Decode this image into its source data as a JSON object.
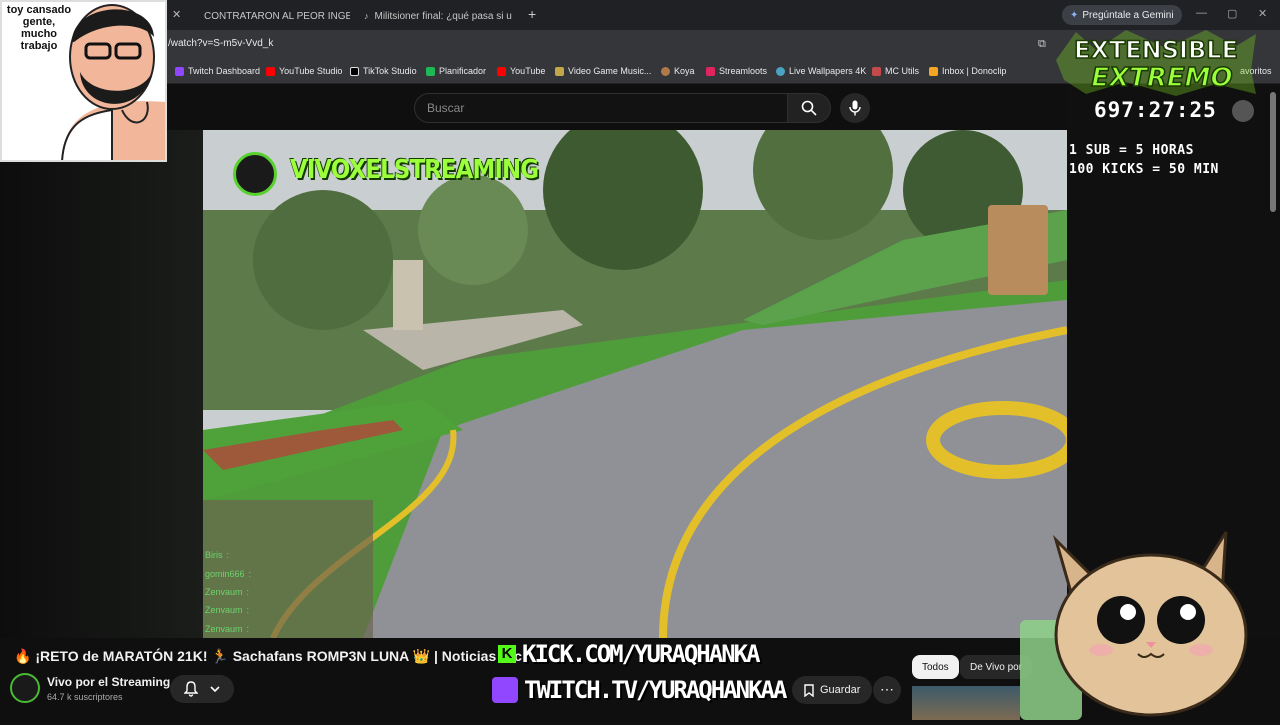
{
  "tabs": [
    {
      "label": "CONTRATARON AL PEOR INGE",
      "icon": "youtube-icon"
    },
    {
      "label": "Militsioner final: ¿qué pasa si u",
      "icon": "tiktok-icon"
    }
  ],
  "address": {
    "url": "/watch?v=S-m5v-Vvd_k"
  },
  "gemini": {
    "label": "Pregúntale a Gemini"
  },
  "bookmarks": [
    {
      "label": "Twitch Dashboard",
      "color": "#9146ff"
    },
    {
      "label": "YouTube Studio",
      "color": "#ff0000"
    },
    {
      "label": "TikTok Studio",
      "color": "#222222"
    },
    {
      "label": "Planificador",
      "color": "#1db954"
    },
    {
      "label": "YouTube",
      "color": "#ff0000"
    },
    {
      "label": "Video Game Music...",
      "color": "#c2a64a"
    },
    {
      "label": "Koya",
      "color": "#b07a4a"
    },
    {
      "label": "Streamloots",
      "color": "#e0245e"
    },
    {
      "label": "Live Wallpapers 4K",
      "color": "#4aa3c2"
    },
    {
      "label": "MC Utils",
      "color": "#c24a4a"
    },
    {
      "label": "Inbox | Donoclip",
      "color": "#f5a623"
    }
  ],
  "bookmarks_overflow": "avoritos",
  "search": {
    "placeholder": "Buscar"
  },
  "overlay": {
    "facecam_text": "toy cansado gente, mucho trabajo",
    "logo_line1": "EXTENSIBLE",
    "logo_line2": "EXTREMO",
    "timer": "697:27:25",
    "rule1": "1 SUB = 5 HORAS",
    "rule2": "100 KICKS = 50 MIN",
    "channel_tag": "VIVOXELSTREAMING",
    "kick_url": "KICK.COM/YURAQHANKA",
    "twitch_url": "TWITCH.TV/YURAQHANKAA",
    "chat": [
      {
        "user": "Biris",
        "msg": ":"
      },
      {
        "user": "gomin666",
        "msg": ":"
      },
      {
        "user": "Zenvaum",
        "msg": ":"
      },
      {
        "user": "Zenvaum",
        "msg": ":"
      },
      {
        "user": "Zenvaum",
        "msg": ":"
      }
    ]
  },
  "video": {
    "title": "🔥 ¡RETO de MARATÓN 21K! 🏃 Sachafans ROMP3N LUNA 👑 | Noticias Kic",
    "channel": "Vivo por el Streaming",
    "subscribers": "64.7 k suscriptores",
    "save_label": "Guardar",
    "more_label": "⋯"
  },
  "chips": [
    {
      "label": "Todos"
    },
    {
      "label": "De Vivo por"
    }
  ]
}
